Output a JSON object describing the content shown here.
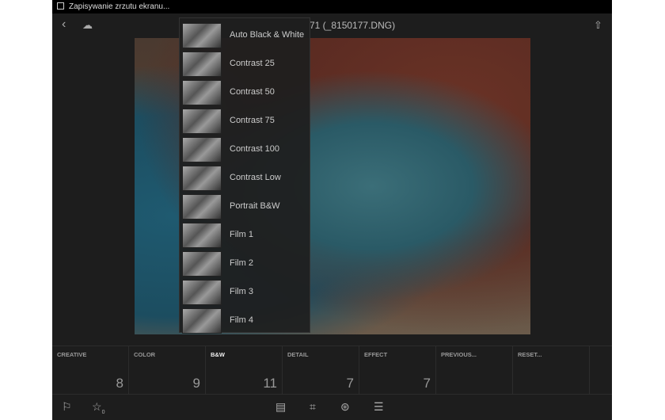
{
  "status_bar": {
    "text": "Zapisywanie zrzutu ekranu..."
  },
  "header": {
    "title": "71 (_8150177.DNG)",
    "icons": [
      "back-icon",
      "cloud-off-icon",
      "share-icon"
    ]
  },
  "preset_menu": {
    "items": [
      "Auto Black & White",
      "Contrast 25",
      "Contrast 50",
      "Contrast 75",
      "Contrast 100",
      "Contrast Low",
      "Portrait B&W",
      "Film 1",
      "Film 2",
      "Film 3",
      "Film 4"
    ]
  },
  "preset_tabs": [
    {
      "label": "CREATIVE",
      "count": "8"
    },
    {
      "label": "COLOR",
      "count": "9"
    },
    {
      "label": "B&W",
      "count": "11",
      "active": true
    },
    {
      "label": "DETAIL",
      "count": "7"
    },
    {
      "label": "EFFECT",
      "count": "7"
    },
    {
      "label": "PREVIOUS...",
      "count": ""
    },
    {
      "label": "RESET...",
      "count": ""
    }
  ],
  "toolbar": {
    "rating": "0",
    "icons": [
      "flag-icon",
      "star-icon",
      "presets-icon",
      "crop-icon",
      "color-icon",
      "adjust-icon"
    ]
  }
}
